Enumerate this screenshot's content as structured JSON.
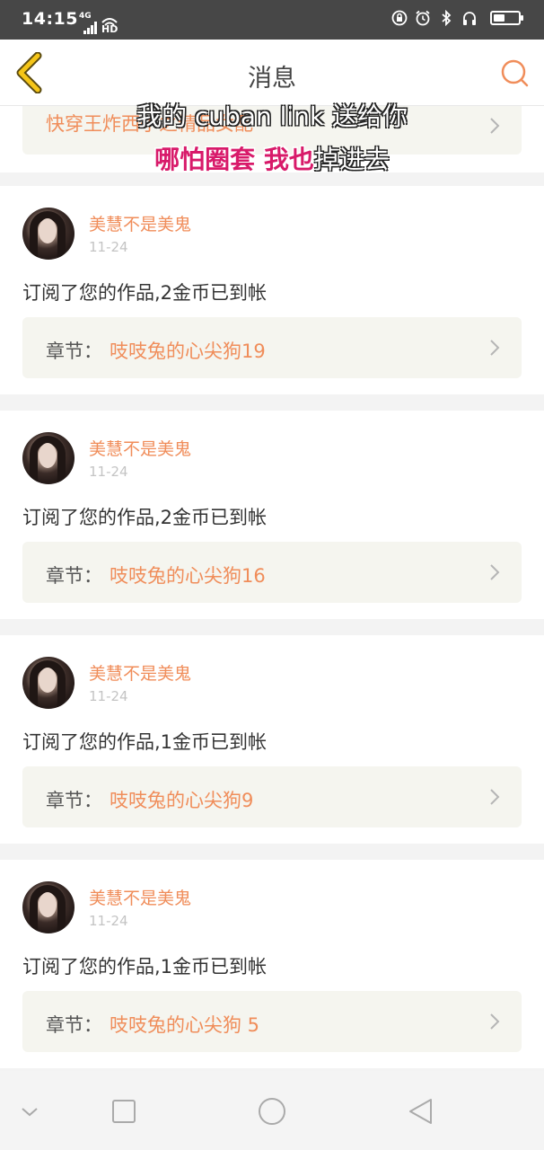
{
  "status_bar": {
    "time": "14:15",
    "network": "4G",
    "hd": "HD",
    "battery_level": 0.45
  },
  "header": {
    "title": "消息"
  },
  "overlay": {
    "line1": "我的 cuban link 送给你",
    "line2_highlight": "哪怕圈套 我也",
    "line2_rest": "掉进去"
  },
  "partial_card": {
    "chapter_title": "快穿王炸西子之精品女配"
  },
  "messages": [
    {
      "user": "美慧不是美鬼",
      "date": "11-24",
      "text": "订阅了您的作品,2金币已到帐",
      "chapter_label": "章节：",
      "chapter_title": "吱吱兔的心尖狗19"
    },
    {
      "user": "美慧不是美鬼",
      "date": "11-24",
      "text": "订阅了您的作品,2金币已到帐",
      "chapter_label": "章节：",
      "chapter_title": "吱吱兔的心尖狗16"
    },
    {
      "user": "美慧不是美鬼",
      "date": "11-24",
      "text": "订阅了您的作品,1金币已到帐",
      "chapter_label": "章节：",
      "chapter_title": "吱吱兔的心尖狗9"
    },
    {
      "user": "美慧不是美鬼",
      "date": "11-24",
      "text": "订阅了您的作品,1金币已到帐",
      "chapter_label": "章节：",
      "chapter_title": "吱吱兔的心尖狗 5"
    }
  ],
  "colors": {
    "accent": "#f08d5a",
    "back_arrow": "#f5c518",
    "overlay_highlight": "#d81a6a"
  }
}
